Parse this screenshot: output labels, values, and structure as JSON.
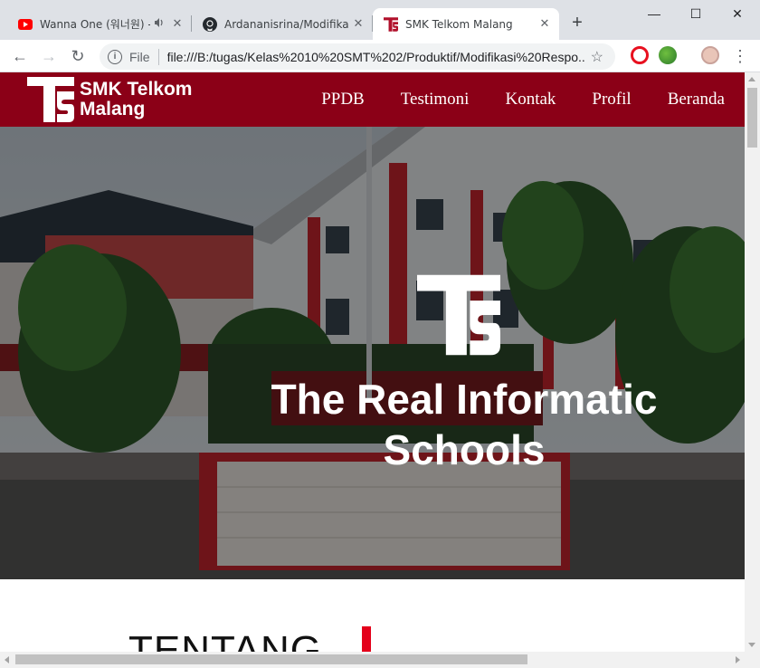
{
  "browser": {
    "tabs": [
      {
        "title": "Wanna One (워너원) -",
        "favicon": "youtube-icon",
        "playing_audio": true
      },
      {
        "title": "Ardananisrina/ModifikasiR",
        "favicon": "github-icon"
      },
      {
        "title": "SMK Telkom Malang",
        "favicon": "ts-logo-icon",
        "active": true
      }
    ],
    "new_tab_symbol": "+",
    "window_controls": {
      "minimize": "—",
      "maximize": "☐",
      "close": "✕"
    },
    "toolbar": {
      "back": "←",
      "forward": "→",
      "reload": "↻",
      "scheme_label": "File",
      "url": "file:///B:/tugas/Kelas%2010%20SMT%202/Produktif/Modifikasi%20Respo...",
      "bookmark_symbol": "☆",
      "menu_symbol": "⋮"
    },
    "colors": {
      "tabstrip": "#dee1e6",
      "active_tab": "#ffffff"
    }
  },
  "site": {
    "brand": {
      "line1": "SMK Telkom",
      "line2": "Malang"
    },
    "nav": [
      "PPDB",
      "Testimoni",
      "Kontak",
      "Profil",
      "Beranda"
    ],
    "hero": {
      "title_line1": "The Real Informatic",
      "title_line2": "Schools"
    },
    "about": {
      "heading": "TENTANG"
    },
    "colors": {
      "primary": "#8b0017",
      "accent": "#e4001b",
      "hero_overlay": "rgba(0,0,0,0.45)"
    }
  }
}
